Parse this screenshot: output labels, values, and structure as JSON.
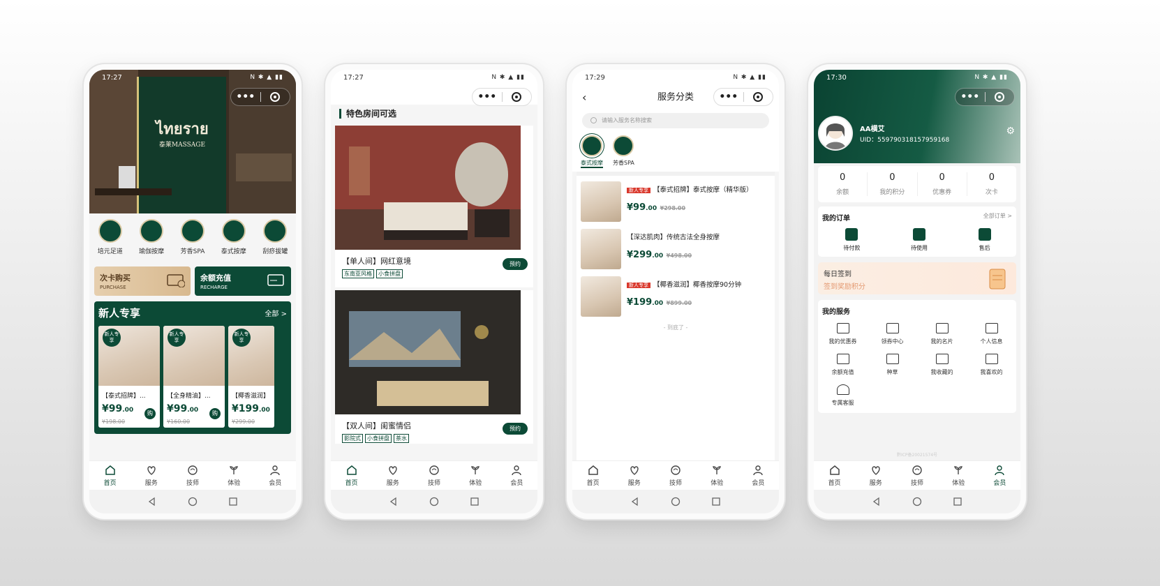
{
  "colors": {
    "brand_green": "#0c4a36",
    "new_tag_red": "#d9382c"
  },
  "status": {
    "p1_time": "17:27",
    "p2_time": "17:27",
    "p3_time": "17:29",
    "p4_time": "17:30"
  },
  "tabs": [
    {
      "label": "首页",
      "icon": "home-icon"
    },
    {
      "label": "服务",
      "icon": "service-icon"
    },
    {
      "label": "技师",
      "icon": "technician-icon"
    },
    {
      "label": "体验",
      "icon": "experience-icon"
    },
    {
      "label": "会员",
      "icon": "member-icon"
    }
  ],
  "p1": {
    "categories": [
      "培元足道",
      "瑜伽按摩",
      "芳香SPA",
      "泰式按摩",
      "刮痧拔罐"
    ],
    "banner_purchase": {
      "title": "次卡购买",
      "sub": "PURCHASE"
    },
    "banner_recharge": {
      "title": "余额充值",
      "sub": "RECHARGE"
    },
    "new_section": {
      "title": "新人专享",
      "all": "全部 >"
    },
    "products": [
      {
        "badge": "新人专享",
        "name": "【泰式招牌】...",
        "price": "¥99",
        "cents": ".00",
        "orig": "¥198.00",
        "buy": "购"
      },
      {
        "badge": "新人专享",
        "name": "【全身精油】...",
        "price": "¥99",
        "cents": ".00",
        "orig": "¥160.00",
        "buy": "购"
      },
      {
        "badge": "新人专享",
        "name": "【椰香滋润】",
        "price": "¥199",
        "cents": ".00",
        "orig": "¥299.00",
        "buy": ""
      }
    ]
  },
  "p2": {
    "section_title": "特色房间可选",
    "rooms": [
      {
        "name": "【单人间】网红意境",
        "tags": [
          "东南亚风格",
          "小食拼盘"
        ],
        "book": "预约"
      },
      {
        "name": "【双人间】闺蜜情侣",
        "tags": [
          "影院式",
          "小食拼盘",
          "茶水"
        ],
        "book": "预约"
      }
    ]
  },
  "p3": {
    "title": "服务分类",
    "search_placeholder": "请输入服务名称搜索",
    "cats": [
      "泰式按摩",
      "芳香SPA"
    ],
    "services": [
      {
        "tag": "新人专享",
        "name": "【泰式招牌】泰式按摩（精华版）",
        "price": "¥99",
        "cents": ".00",
        "orig": "¥298.00"
      },
      {
        "tag": "",
        "name": "【深达肌肉】传统古法全身按摩",
        "price": "¥299",
        "cents": ".00",
        "orig": "¥498.00"
      },
      {
        "tag": "新人专享",
        "name": "【椰香滋润】椰香按摩90分钟",
        "price": "¥199",
        "cents": ".00",
        "orig": "¥899.00"
      }
    ],
    "end": "- 到底了 -"
  },
  "p4": {
    "username": "AA横艾",
    "uid": "UID：559790318157959168",
    "stats": [
      {
        "value": "0",
        "label": "余额"
      },
      {
        "value": "0",
        "label": "我的积分"
      },
      {
        "value": "0",
        "label": "优惠券"
      },
      {
        "value": "0",
        "label": "次卡"
      }
    ],
    "orders": {
      "title": "我的订单",
      "more": "全部订单 >",
      "items": [
        "待付款",
        "待使用",
        "售后"
      ]
    },
    "signin": {
      "title": "每日签到",
      "sub": "签到奖励积分"
    },
    "services": {
      "title": "我的服务",
      "items": [
        "我的优惠券",
        "领券中心",
        "我的名片",
        "个人信息",
        "余额充值",
        "种草",
        "我收藏的",
        "我喜欢的",
        "专属客服"
      ]
    },
    "icp": "黔ICP备20021574号"
  }
}
